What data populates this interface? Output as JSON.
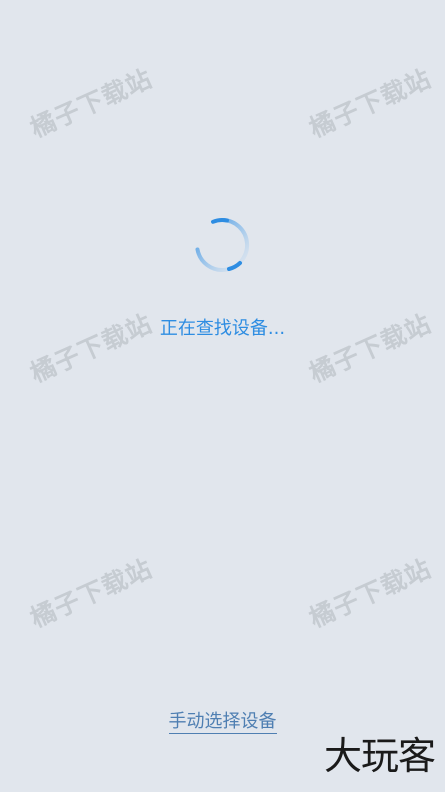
{
  "status": {
    "searching_label": "正在查找设备..."
  },
  "actions": {
    "manual_select_label": "手动选择设备"
  },
  "watermark": {
    "text": "橘子下载站"
  },
  "brand": {
    "logo_text": "大玩客"
  },
  "colors": {
    "background": "#e1e6ed",
    "accent": "#2e8de2",
    "link": "#4f7fb2",
    "watermark": "#969ba0",
    "logo": "#1a1a1a"
  }
}
